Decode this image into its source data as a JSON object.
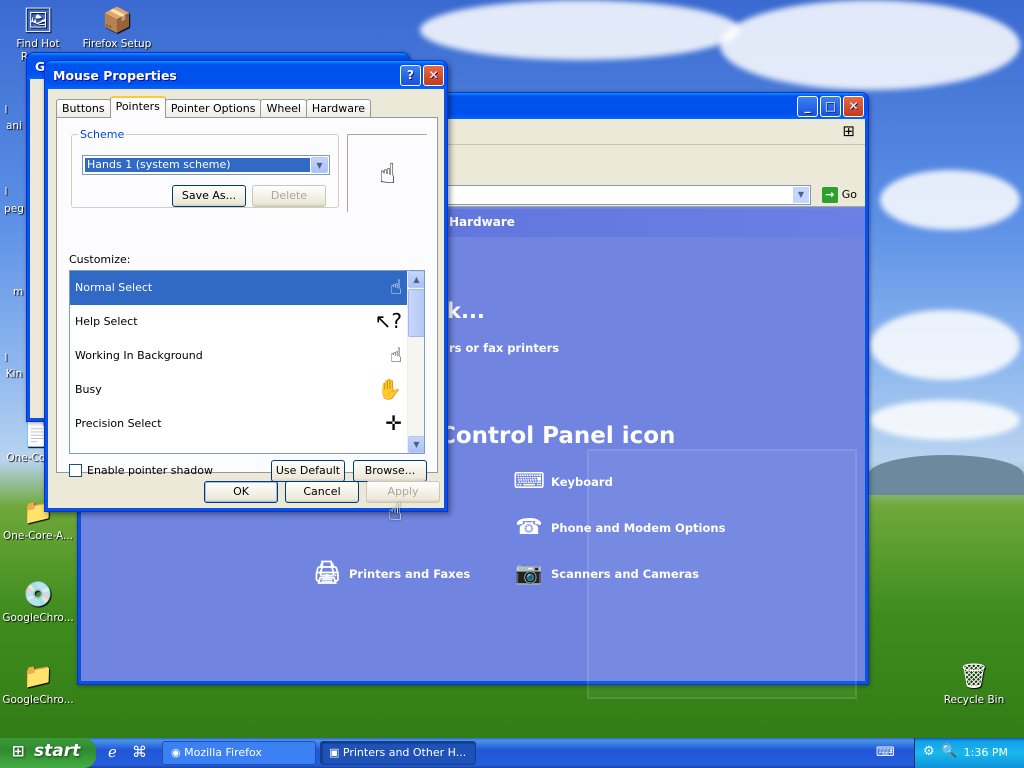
{
  "desktop": {
    "icons": [
      {
        "label": "Find Hot Russ...",
        "icon": "app-icon"
      },
      {
        "label": "Firefox Setup",
        "icon": "installer-icon"
      },
      {
        "label": "One-Core-...",
        "icon": "file-icon"
      },
      {
        "label": "One-Core-A...",
        "icon": "folder-icon"
      },
      {
        "label": "GoogleChro...",
        "icon": "installer-icon"
      },
      {
        "label": "GoogleChro...",
        "icon": "folder-icon"
      },
      {
        "label": "Recycle Bin",
        "icon": "recycle-bin-icon"
      }
    ],
    "partial_labels": [
      "l",
      "ani",
      "l",
      "peg",
      "m",
      "l",
      "Kin"
    ]
  },
  "behind_window": {
    "title": "Ge"
  },
  "control_panel": {
    "address_go": "Go",
    "header": "Hardware",
    "pick_task_partial": "k...",
    "task_link_partial": "rs or fax printers",
    "pick_icon_partial": "Control Panel icon",
    "items": [
      {
        "label": "Keyboard",
        "icon": "keyboard-icon"
      },
      {
        "label": "Phone and Modem Options",
        "icon": "phone-icon"
      },
      {
        "label": "Printers and Faxes",
        "icon": "printer-icon"
      },
      {
        "label": "Scanners and Cameras",
        "icon": "scanner-icon"
      }
    ]
  },
  "mouse_properties": {
    "title": "Mouse Properties",
    "help_button": "?",
    "close_button": "✕",
    "tabs": [
      "Buttons",
      "Pointers",
      "Pointer Options",
      "Wheel",
      "Hardware"
    ],
    "active_tab": "Pointers",
    "scheme": {
      "legend": "Scheme",
      "selected": "Hands 1 (system scheme)",
      "save_as": "Save As...",
      "delete": "Delete"
    },
    "customize_label": "Customize:",
    "pointers": [
      {
        "label": "Normal Select",
        "selected": true
      },
      {
        "label": "Help Select",
        "selected": false
      },
      {
        "label": "Working In Background",
        "selected": false
      },
      {
        "label": "Busy",
        "selected": false
      },
      {
        "label": "Precision Select",
        "selected": false
      }
    ],
    "enable_shadow": {
      "label": "Enable pointer shadow",
      "checked": false
    },
    "use_default": "Use Default",
    "browse": "Browse...",
    "ok": "OK",
    "cancel": "Cancel",
    "apply": "Apply"
  },
  "taskbar": {
    "start": "start",
    "tasks": [
      {
        "label": "Mozilla Firefox",
        "active": false
      },
      {
        "label": "Printers and Other H...",
        "active": true
      }
    ],
    "clock": "1:36 PM"
  },
  "colors": {
    "xp_blue": "#0a53e0",
    "selection": "#316ac5",
    "dialog_face": "#ece9d8",
    "start_green": "#3c9a3c"
  }
}
